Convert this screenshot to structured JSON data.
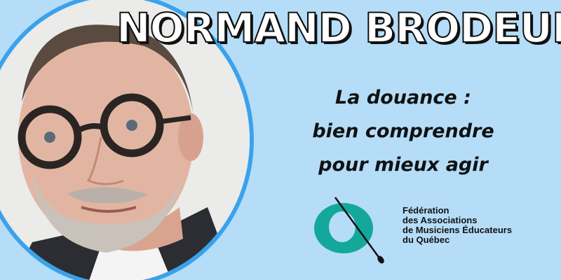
{
  "speaker": {
    "name": "NORMAND BRODEUR"
  },
  "talk": {
    "lines": [
      "La douance :",
      "bien comprendre",
      "pour mieux agir"
    ]
  },
  "organization": {
    "lines": [
      "Fédération",
      "des Associations",
      "de Musiciens Éducateurs",
      "du Québec"
    ],
    "logo_icon": "fameq-logo-icon"
  },
  "colors": {
    "background": "#b5ddf8",
    "ring": "#3aa2ec",
    "logo_teal": "#14a89a",
    "text": "#111111"
  }
}
